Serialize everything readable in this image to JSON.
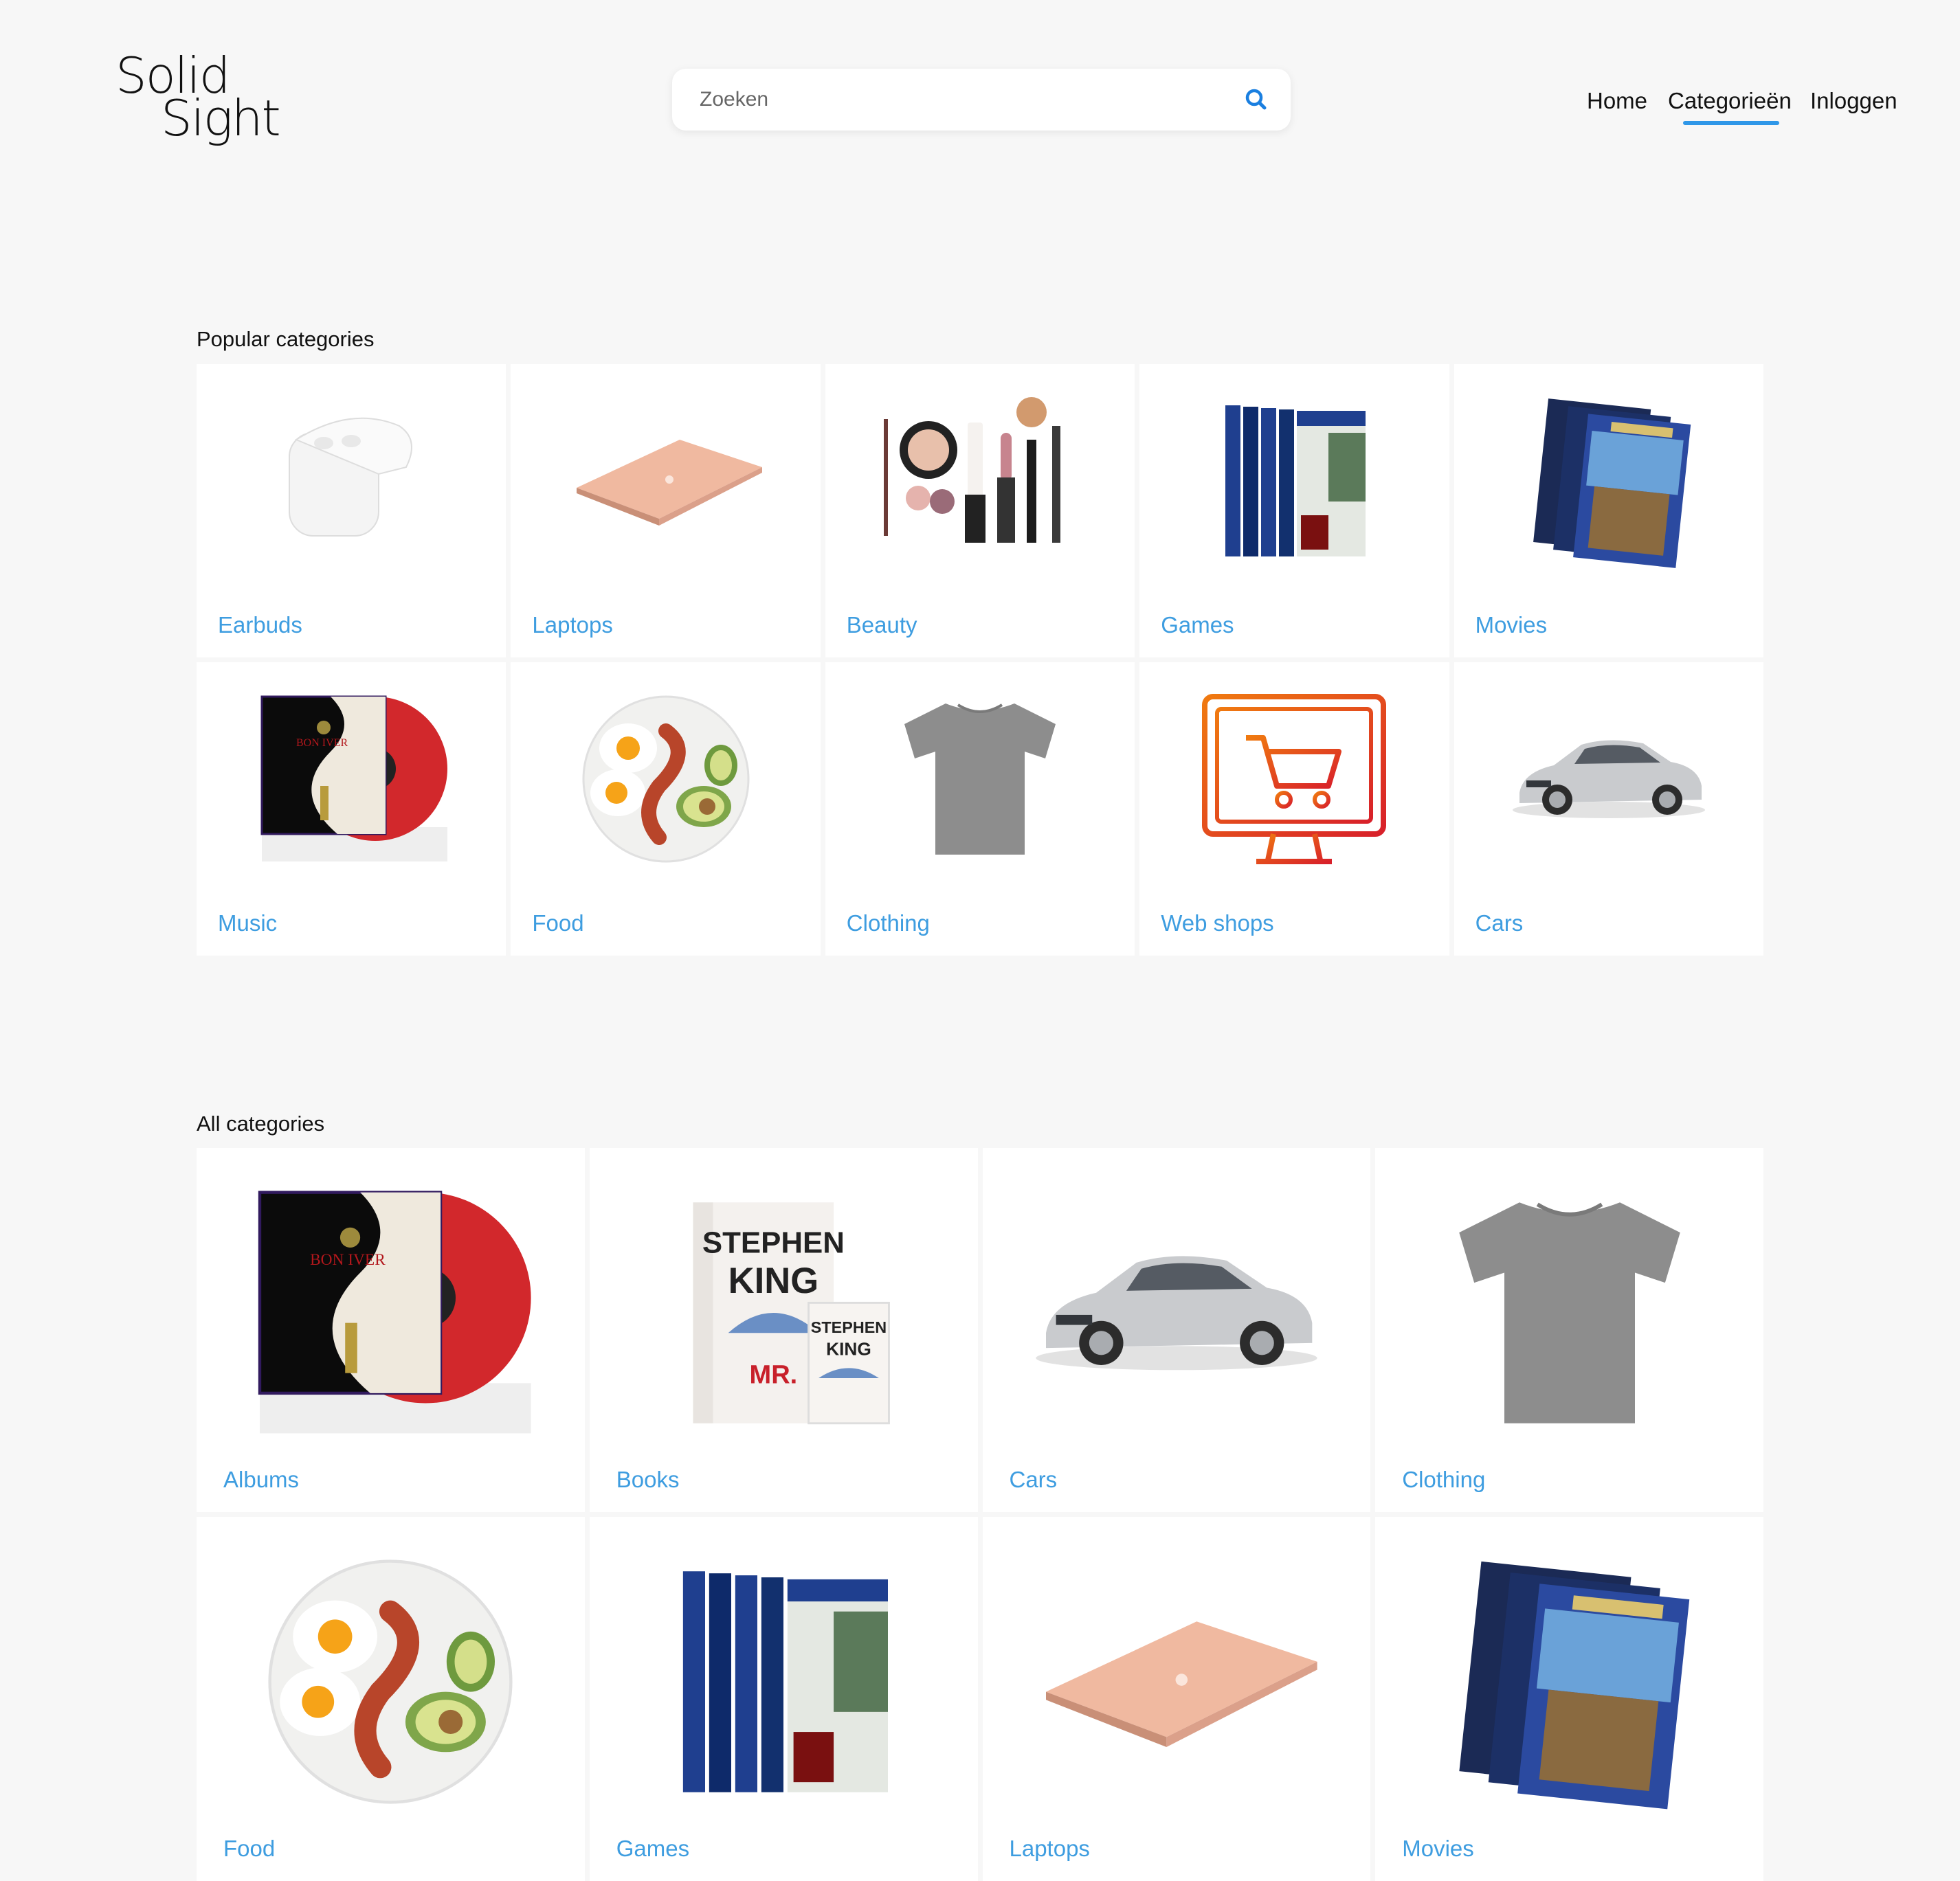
{
  "header": {
    "logo_line1": "Solid",
    "logo_line2": "Sight",
    "search_placeholder": "Zoeken",
    "search_icon": "search-icon",
    "nav": {
      "home": "Home",
      "categories": "Categorieën",
      "login": "Inloggen"
    },
    "accent_color": "#2f97e8"
  },
  "popular": {
    "title": "Popular categories",
    "items": [
      {
        "label": "Earbuds",
        "icon": "earbuds-case-image"
      },
      {
        "label": "Laptops",
        "icon": "laptop-image"
      },
      {
        "label": "Beauty",
        "icon": "makeup-image"
      },
      {
        "label": "Games",
        "icon": "game-boxes-image"
      },
      {
        "label": "Movies",
        "icon": "dvd-cases-image"
      },
      {
        "label": "Music",
        "icon": "vinyl-album-image"
      },
      {
        "label": "Food",
        "icon": "breakfast-plate-image"
      },
      {
        "label": "Clothing",
        "icon": "tshirt-image"
      },
      {
        "label": "Web shops",
        "icon": "shopping-cart-monitor-icon"
      },
      {
        "label": "Cars",
        "icon": "car-image"
      }
    ]
  },
  "all": {
    "title": "All categories",
    "items": [
      {
        "label": "Albums",
        "icon": "vinyl-album-image"
      },
      {
        "label": "Books",
        "icon": "books-image"
      },
      {
        "label": "Cars",
        "icon": "car-image"
      },
      {
        "label": "Clothing",
        "icon": "tshirt-image"
      },
      {
        "label": "Food",
        "icon": "breakfast-plate-image"
      },
      {
        "label": "Games",
        "icon": "game-boxes-image"
      },
      {
        "label": "Laptops",
        "icon": "laptop-image"
      },
      {
        "label": "Movies",
        "icon": "dvd-cases-image"
      }
    ]
  },
  "label_color": "#3e9de0"
}
